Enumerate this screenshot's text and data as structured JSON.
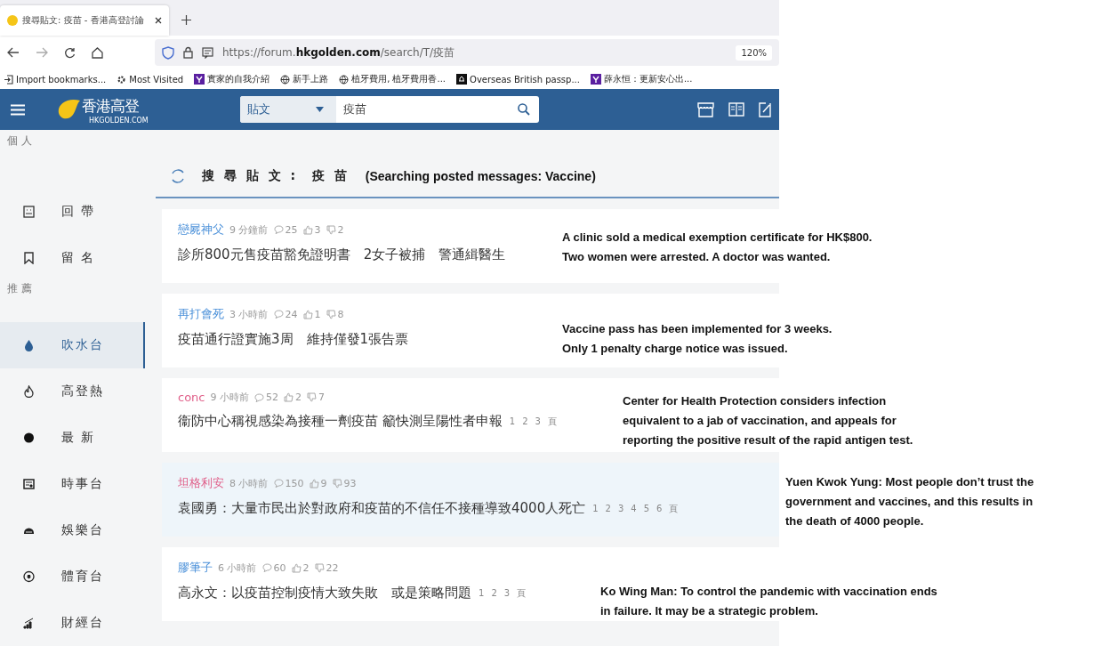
{
  "browser": {
    "tab_title": "搜尋貼文: 疫苗 - 香港高登討論",
    "url": "https://forum.**hkgolden.com**/search/T/疫苗",
    "zoom": "120%",
    "bookmarks": [
      {
        "label": "Import bookmarks..."
      },
      {
        "label": "Most Visited"
      },
      {
        "label": "實家的自我介紹"
      },
      {
        "label": "新手上路"
      },
      {
        "label": "植牙費用, 植牙費用香..."
      },
      {
        "label": "Overseas British passp..."
      },
      {
        "label": "薛永恒：更新安心出..."
      }
    ]
  },
  "header": {
    "logo_text": "香港高登",
    "logo_subtext": "HKGOLDEN.COM",
    "search_scope": "貼文",
    "search_value": "疫苗"
  },
  "sidebar": {
    "sections": [
      {
        "label": "個 人",
        "items": [
          {
            "label": "回 帶",
            "selected": false
          },
          {
            "label": "留 名",
            "selected": false
          }
        ]
      },
      {
        "label": "推 薦",
        "items": [
          {
            "label": "吹水台",
            "selected": true
          },
          {
            "label": "高登熱",
            "selected": false
          },
          {
            "label": "最 新",
            "selected": false
          },
          {
            "label": "時事台",
            "selected": false
          },
          {
            "label": "娛樂台",
            "selected": false
          },
          {
            "label": "體育台",
            "selected": false
          },
          {
            "label": "財經台",
            "selected": false
          }
        ]
      }
    ]
  },
  "page_title": "搜 尋 貼 文 :  疫 苗",
  "page_title_translation": "(Searching posted messages: Vaccine)",
  "posts": [
    {
      "author": "戀屍神父",
      "color": "#4a90d9",
      "time": "9 分鐘前",
      "replies": "25",
      "likes": "3",
      "dislikes": "2",
      "title": "診所800元售疫苗豁免證明書　2女子被捕　警通緝醫生",
      "selected": false
    },
    {
      "author": "再打會死",
      "color": "#4a90d9",
      "time": "3 小時前",
      "replies": "24",
      "likes": "1",
      "dislikes": "8",
      "title": "疫苗通行證實施3周　維持僅發1張告票",
      "selected": false
    },
    {
      "author": "conc",
      "color": "#e0608a",
      "time": "9 小時前",
      "replies": "52",
      "likes": "2",
      "dislikes": "7",
      "title": "衞防中心稱視感染為接種一劑疫苗 籲快測呈陽性者申報",
      "pages": [
        "1",
        "2",
        "3"
      ],
      "pages_label": "頁",
      "selected": false
    },
    {
      "author": "坦格利安",
      "color": "#e0608a",
      "time": "8 小時前",
      "replies": "150",
      "likes": "9",
      "dislikes": "93",
      "title": "袁國勇：大量市民出於對政府和疫苗的不信任不接種導致4000人死亡",
      "pages": [
        "1",
        "2",
        "3",
        "4",
        "5",
        "6"
      ],
      "pages_label": "頁",
      "selected": true
    },
    {
      "author": "膠筆子",
      "color": "#4a90d9",
      "time": "6 小時前",
      "replies": "60",
      "likes": "2",
      "dislikes": "22",
      "title": "高永文：以疫苗控制疫情大致失敗　或是策略問題",
      "pages": [
        "1",
        "2",
        "3"
      ],
      "pages_label": "頁",
      "selected": false
    }
  ],
  "annotations": [
    {
      "lines": [
        "A clinic sold a medical exemption certificate for HK$800.",
        "Two women were arrested.  A doctor was wanted."
      ]
    },
    {
      "lines": [
        "Vaccine pass has been implemented for 3 weeks.",
        "Only 1 penalty charge notice was issued."
      ]
    },
    {
      "lines": [
        "Center for Health Protection considers infection",
        "equivalent to a jab of vaccination, and appeals for",
        "reporting the positive result of the rapid antigen test."
      ]
    },
    {
      "lines": [
        "Yuen Kwok Yung: Most people don’t trust the",
        "government and vaccines, and this results in",
        "the death of 4000 people."
      ]
    },
    {
      "lines": [
        "Ko Wing Man: To control the pandemic with vaccination ends",
        "in failure. It may be a strategic problem."
      ]
    }
  ]
}
